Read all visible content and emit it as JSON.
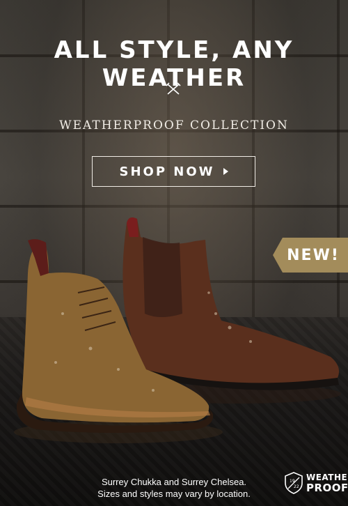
{
  "headline": "ALL STYLE, ANY WEATHER",
  "subhead": "WEATHERPROOF COLLECTION",
  "cta": {
    "label": "SHOP NOW"
  },
  "badge": "NEW!",
  "caption": {
    "line1": "Surrey Chukka and Surrey Chelsea.",
    "line2": "Sizes and styles may vary by location."
  },
  "logo": {
    "year_top": "19",
    "year_bottom": "22",
    "word1": "WEATHER",
    "word2": "PROOF"
  },
  "icons": {
    "divider": "crossed-tools-icon",
    "arrow": "play-arrow-icon"
  },
  "colors": {
    "badge": "#a38c5b",
    "text": "#ffffff",
    "background": "#3b3833"
  }
}
